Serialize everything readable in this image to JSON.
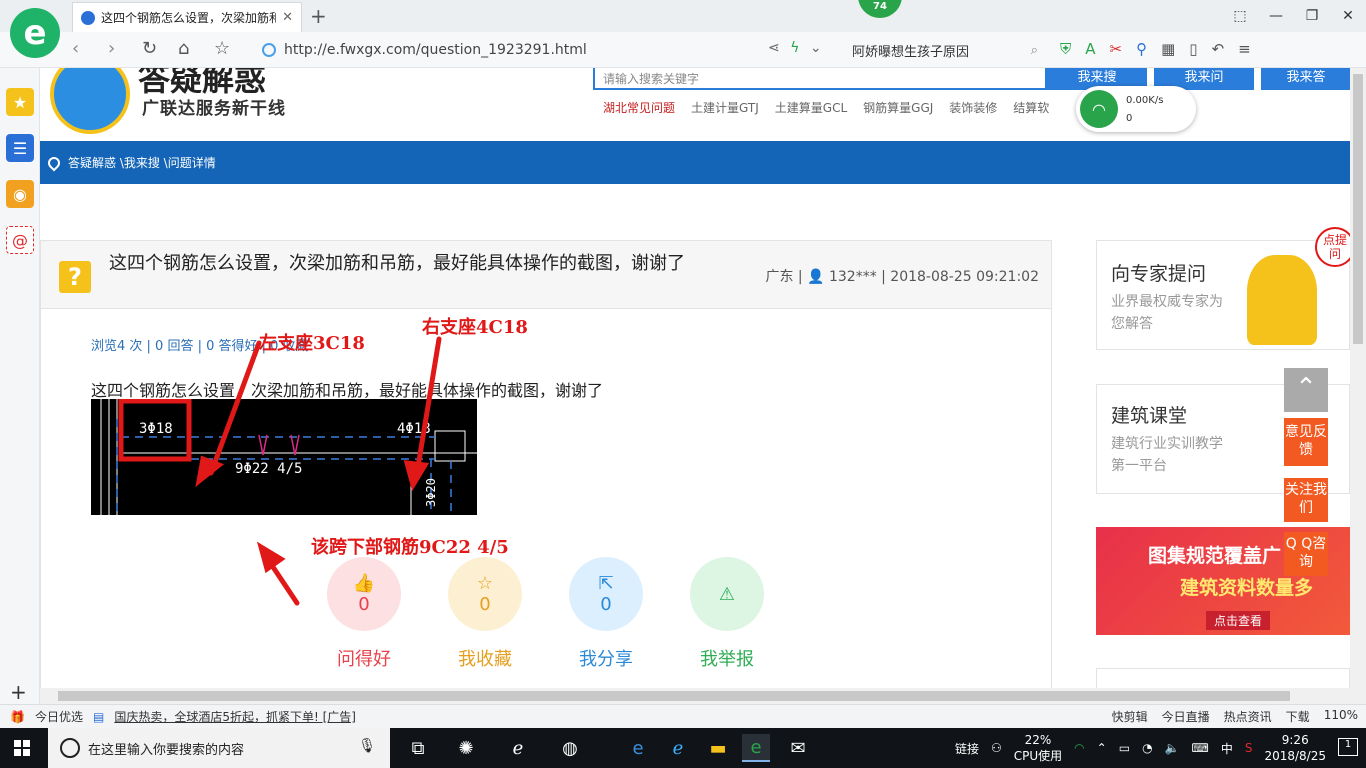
{
  "browser": {
    "tab_title": "这四个钢筋怎么设置，次梁加筋和",
    "tab_close": "✕",
    "new_tab": "+",
    "badge_count": "74",
    "url": "http://e.fwxgx.com/question_1923291.html",
    "search_text": "阿娇曝想生孩子原因",
    "window_buttons": [
      "⬚",
      "—",
      "❐",
      "✕"
    ]
  },
  "site": {
    "logo_title": "答疑解惑",
    "logo_subtitle": "广联达服务新干线",
    "search_placeholder": "请输入搜索关键字",
    "search_buttons": [
      "我来搜",
      "我来问",
      "我来答"
    ],
    "hot_links": [
      "湖北常见问题",
      "土建计量GTJ",
      "土建算量GCL",
      "钢筋算量GGJ",
      "装饰装修",
      "结算软"
    ],
    "net_speed": "0.00K/s",
    "net_count": "0"
  },
  "breadcrumb": "答疑解惑 \\我来搜 \\问题详情",
  "question": {
    "title": "这四个钢筋怎么设置，次梁加筋和吊筋，最好能具体操作的截图，谢谢了",
    "meta": "广东 | 👤 132*** | 2018-08-25 09:21:02",
    "stats": "浏览4 次 | 0 回答 | 0 答得好 | 0 收藏",
    "description": "这四个钢筋怎么设置，次梁加筋和吊筋，最好能具体操作的截图，谢谢了"
  },
  "cad": {
    "left_rebar": "3Φ18",
    "right_rebar": "4Φ18",
    "bottom_rebar": "9Φ22 4/5",
    "side_rebar": "3Φ20"
  },
  "annotations": {
    "left": "左支座3C18",
    "right": "右支座4C18",
    "bottom": "该跨下部钢筋9C22 4/5"
  },
  "actions": [
    {
      "label": "问得好",
      "count": "0",
      "icon": "thumbs-up-icon",
      "color": "#e8424a",
      "bg": "#fde0e2"
    },
    {
      "label": "我收藏",
      "count": "0",
      "icon": "star-icon",
      "color": "#e6a020",
      "bg": "#fdf0d2"
    },
    {
      "label": "我分享",
      "count": "0",
      "icon": "share-icon",
      "color": "#2a8ad8",
      "bg": "#dcefff"
    },
    {
      "label": "我举报",
      "count": "",
      "icon": "warning-icon",
      "color": "#2fae55",
      "bg": "#ddf5e3"
    }
  ],
  "right_column": {
    "expert_title": "向专家提问",
    "expert_sub": "业界最权威专家为您解答",
    "expert_bubble": "点提问",
    "class_title": "建筑课堂",
    "class_sub": "建筑行业实训教学第一平台",
    "ad_line1": "图集规范覆盖广",
    "ad_line2": "建筑资料数量多",
    "ad_button": "点击查看",
    "float_feedback": "意见反馈",
    "float_follow": "关注我们",
    "float_qq": "Q Q咨询"
  },
  "statusbar": {
    "today": "今日优选",
    "ad": "国庆热卖，全球酒店5折起，抓紧下单! [广告]",
    "right_items": [
      "快剪辑",
      "今日直播",
      "热点资讯",
      "下载",
      "110%"
    ]
  },
  "taskbar": {
    "search_placeholder": "在这里输入你要搜索的内容",
    "link_label": "链接",
    "cpu_percent": "22%",
    "cpu_label": "CPU使用",
    "ime": "中",
    "time": "9:26",
    "date": "2018/8/25",
    "notifications": "1"
  }
}
